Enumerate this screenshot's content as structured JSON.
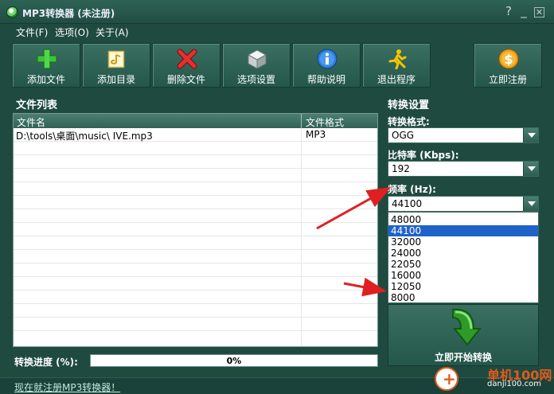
{
  "window": {
    "title": "MP3转换器 (未注册)",
    "help_glyph": "?",
    "minimize_glyph": "_",
    "close_glyph": "✕"
  },
  "menu": [
    {
      "label": "文件(F)"
    },
    {
      "label": "选项(O)"
    },
    {
      "label": "关于(A)"
    }
  ],
  "toolbar": {
    "add_file": "添加文件",
    "add_dir": "添加目录",
    "delete_file": "删除文件",
    "options": "选项设置",
    "help": "帮助说明",
    "exit": "退出程序",
    "register": "立即注册"
  },
  "file_list": {
    "title": "文件列表",
    "columns": {
      "name": "文件名",
      "format": "文件格式"
    },
    "rows": [
      {
        "name": "D:\\tools\\桌面\\music\\ IVE.mp3",
        "format": "MP3"
      }
    ]
  },
  "settings": {
    "title": "转换设置",
    "format_label": "转换格式:",
    "format_value": "OGG",
    "bitrate_label": "比特率 (Kbps):",
    "bitrate_value": "192",
    "frequency_label": "频率 (Hz):",
    "frequency_value": "44100",
    "frequency_options": [
      "48000",
      "44100",
      "32000",
      "24000",
      "22050",
      "16000",
      "12050",
      "8000"
    ],
    "frequency_selected": "44100"
  },
  "convert_button": "立即开始转换",
  "progress": {
    "label": "转换进度 (%):",
    "value_text": "0%",
    "value": 0
  },
  "status": {
    "link": "现在就注册MP3转换器！"
  },
  "watermark": {
    "text": "单机100网",
    "sub": "danji100.com"
  },
  "colors": {
    "accent": "#1f63c9",
    "annotation_arrow": "#e02020",
    "background": "#1f4a40"
  }
}
